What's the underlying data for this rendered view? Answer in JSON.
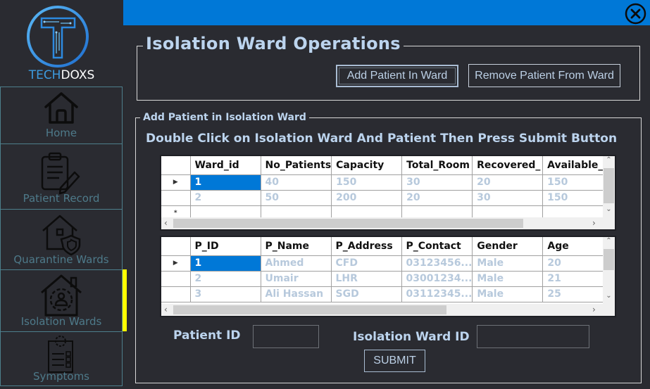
{
  "brand": {
    "part1": "TECH",
    "part2": "DOXS"
  },
  "sidebar": {
    "items": [
      {
        "label": "Home",
        "icon": "home-icon"
      },
      {
        "label": "Patient Record",
        "icon": "clipboard-pencil-icon"
      },
      {
        "label": "Quarantine Wards",
        "icon": "house-shield-icon"
      },
      {
        "label": "Isolation Wards",
        "icon": "house-person-icon",
        "active": true
      },
      {
        "label": "Symptoms",
        "icon": "checklist-gear-icon"
      }
    ],
    "active_indicator_color": "#ffff00"
  },
  "header": {
    "bar_color": "#0078d7",
    "close_icon": "close-circle-icon"
  },
  "operations": {
    "title": "Isolation Ward Operations",
    "add_button": "Add Patient In Ward",
    "remove_button": "Remove Patient From Ward"
  },
  "add_section": {
    "title": "Add Patient  in Isolation Ward",
    "instruction": "Double Click on Isolation Ward And Patient Then Press Submit Button",
    "ward_grid": {
      "columns": [
        "Ward_id",
        "No_Patients",
        "Capacity",
        "Total_Room",
        "Recovered_",
        "Available_"
      ],
      "rows": [
        [
          "1",
          "40",
          "150",
          "30",
          "20",
          "150"
        ],
        [
          "2",
          "50",
          "200",
          "20",
          "30",
          "150"
        ]
      ],
      "selected_row": 0,
      "new_row_marker": "*"
    },
    "patient_grid": {
      "columns": [
        "P_ID",
        "P_Name",
        "P_Address",
        "P_Contact",
        "Gender",
        "Age"
      ],
      "rows": [
        [
          "1",
          "Ahmed",
          "CFD",
          "03123456...",
          "Male",
          "20"
        ],
        [
          "2",
          "Umair",
          "LHR",
          "03001234...",
          "Male",
          "21"
        ],
        [
          "3",
          "Ali Hassan",
          "SGD",
          "03112345...",
          "Male",
          "25"
        ]
      ],
      "selected_row": 0
    },
    "form": {
      "patient_id_label": "Patient ID",
      "patient_id_value": "",
      "ward_id_label": "Isolation Ward ID",
      "ward_id_value": "",
      "submit_label": "SUBMIT"
    }
  }
}
